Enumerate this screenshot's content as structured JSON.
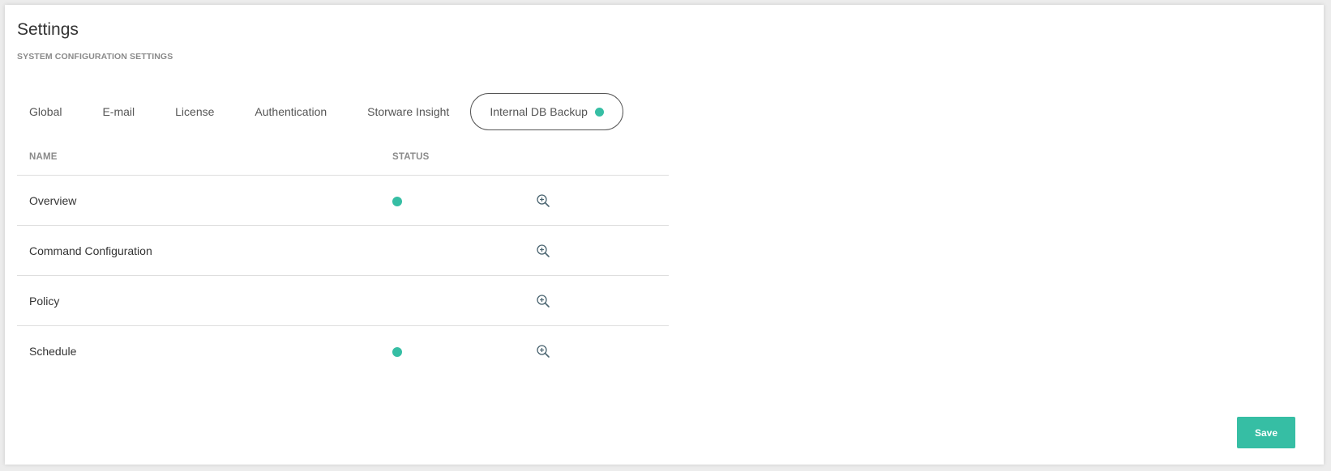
{
  "page": {
    "title": "Settings",
    "subtitle": "SYSTEM CONFIGURATION SETTINGS"
  },
  "tabs": [
    {
      "label": "Global",
      "active": false
    },
    {
      "label": "E-mail",
      "active": false
    },
    {
      "label": "License",
      "active": false
    },
    {
      "label": "Authentication",
      "active": false
    },
    {
      "label": "Storware Insight",
      "active": false
    },
    {
      "label": "Internal DB Backup",
      "active": true,
      "indicator": "status-dot"
    }
  ],
  "table": {
    "columns": [
      "NAME",
      "STATUS"
    ],
    "rows": [
      {
        "name": "Overview",
        "status_ok": true,
        "action_icon": "zoom-in-icon"
      },
      {
        "name": "Command Configuration",
        "status_ok": false,
        "action_icon": "zoom-in-icon"
      },
      {
        "name": "Policy",
        "status_ok": false,
        "action_icon": "zoom-in-icon"
      },
      {
        "name": "Schedule",
        "status_ok": true,
        "action_icon": "zoom-in-icon"
      }
    ]
  },
  "actions": {
    "save_label": "Save"
  },
  "colors": {
    "accent": "#36bea4",
    "icon": "#4a6470"
  }
}
